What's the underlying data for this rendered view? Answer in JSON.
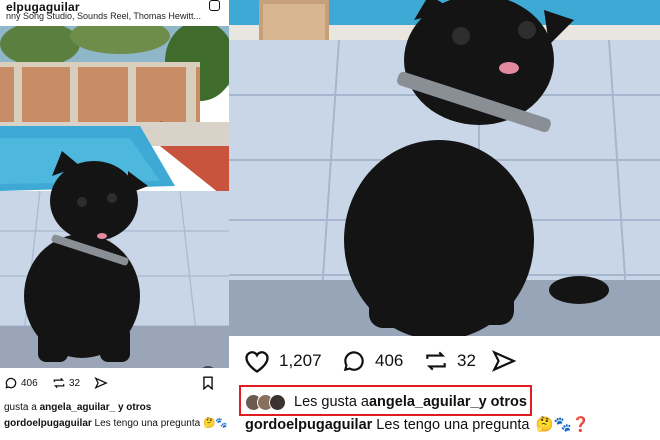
{
  "left_post": {
    "username": "elpugaguilar",
    "music": "nny Song Studio, Sounds Reel, Thomas Hewitt...",
    "comments": "406",
    "reposts": "32",
    "liked_by_prefix": "gusta a ",
    "liked_by_user": "angela_aguilar_",
    "liked_by_suffix": " y otros",
    "caption_user": "gordoelpugaguilar",
    "caption_text": " Les tengo una pregunta ",
    "caption_emoji": "🤔🐾❓"
  },
  "right_post": {
    "likes": "1,207",
    "comments": "406",
    "reposts": "32",
    "liked_by_prefix": "Les gusta a ",
    "liked_by_user": "angela_aguilar_",
    "liked_by_suffix": " y otros",
    "caption_user": "gordoelpugaguilar",
    "caption_text": " Les tengo una pregunta",
    "caption_emoji": "🤔🐾❓"
  },
  "colors": {
    "highlight_box": "#e11b22",
    "pool_water": "#3ea9d4",
    "floor_tile": "#c9d6e8",
    "pug_fur": "#141414"
  }
}
